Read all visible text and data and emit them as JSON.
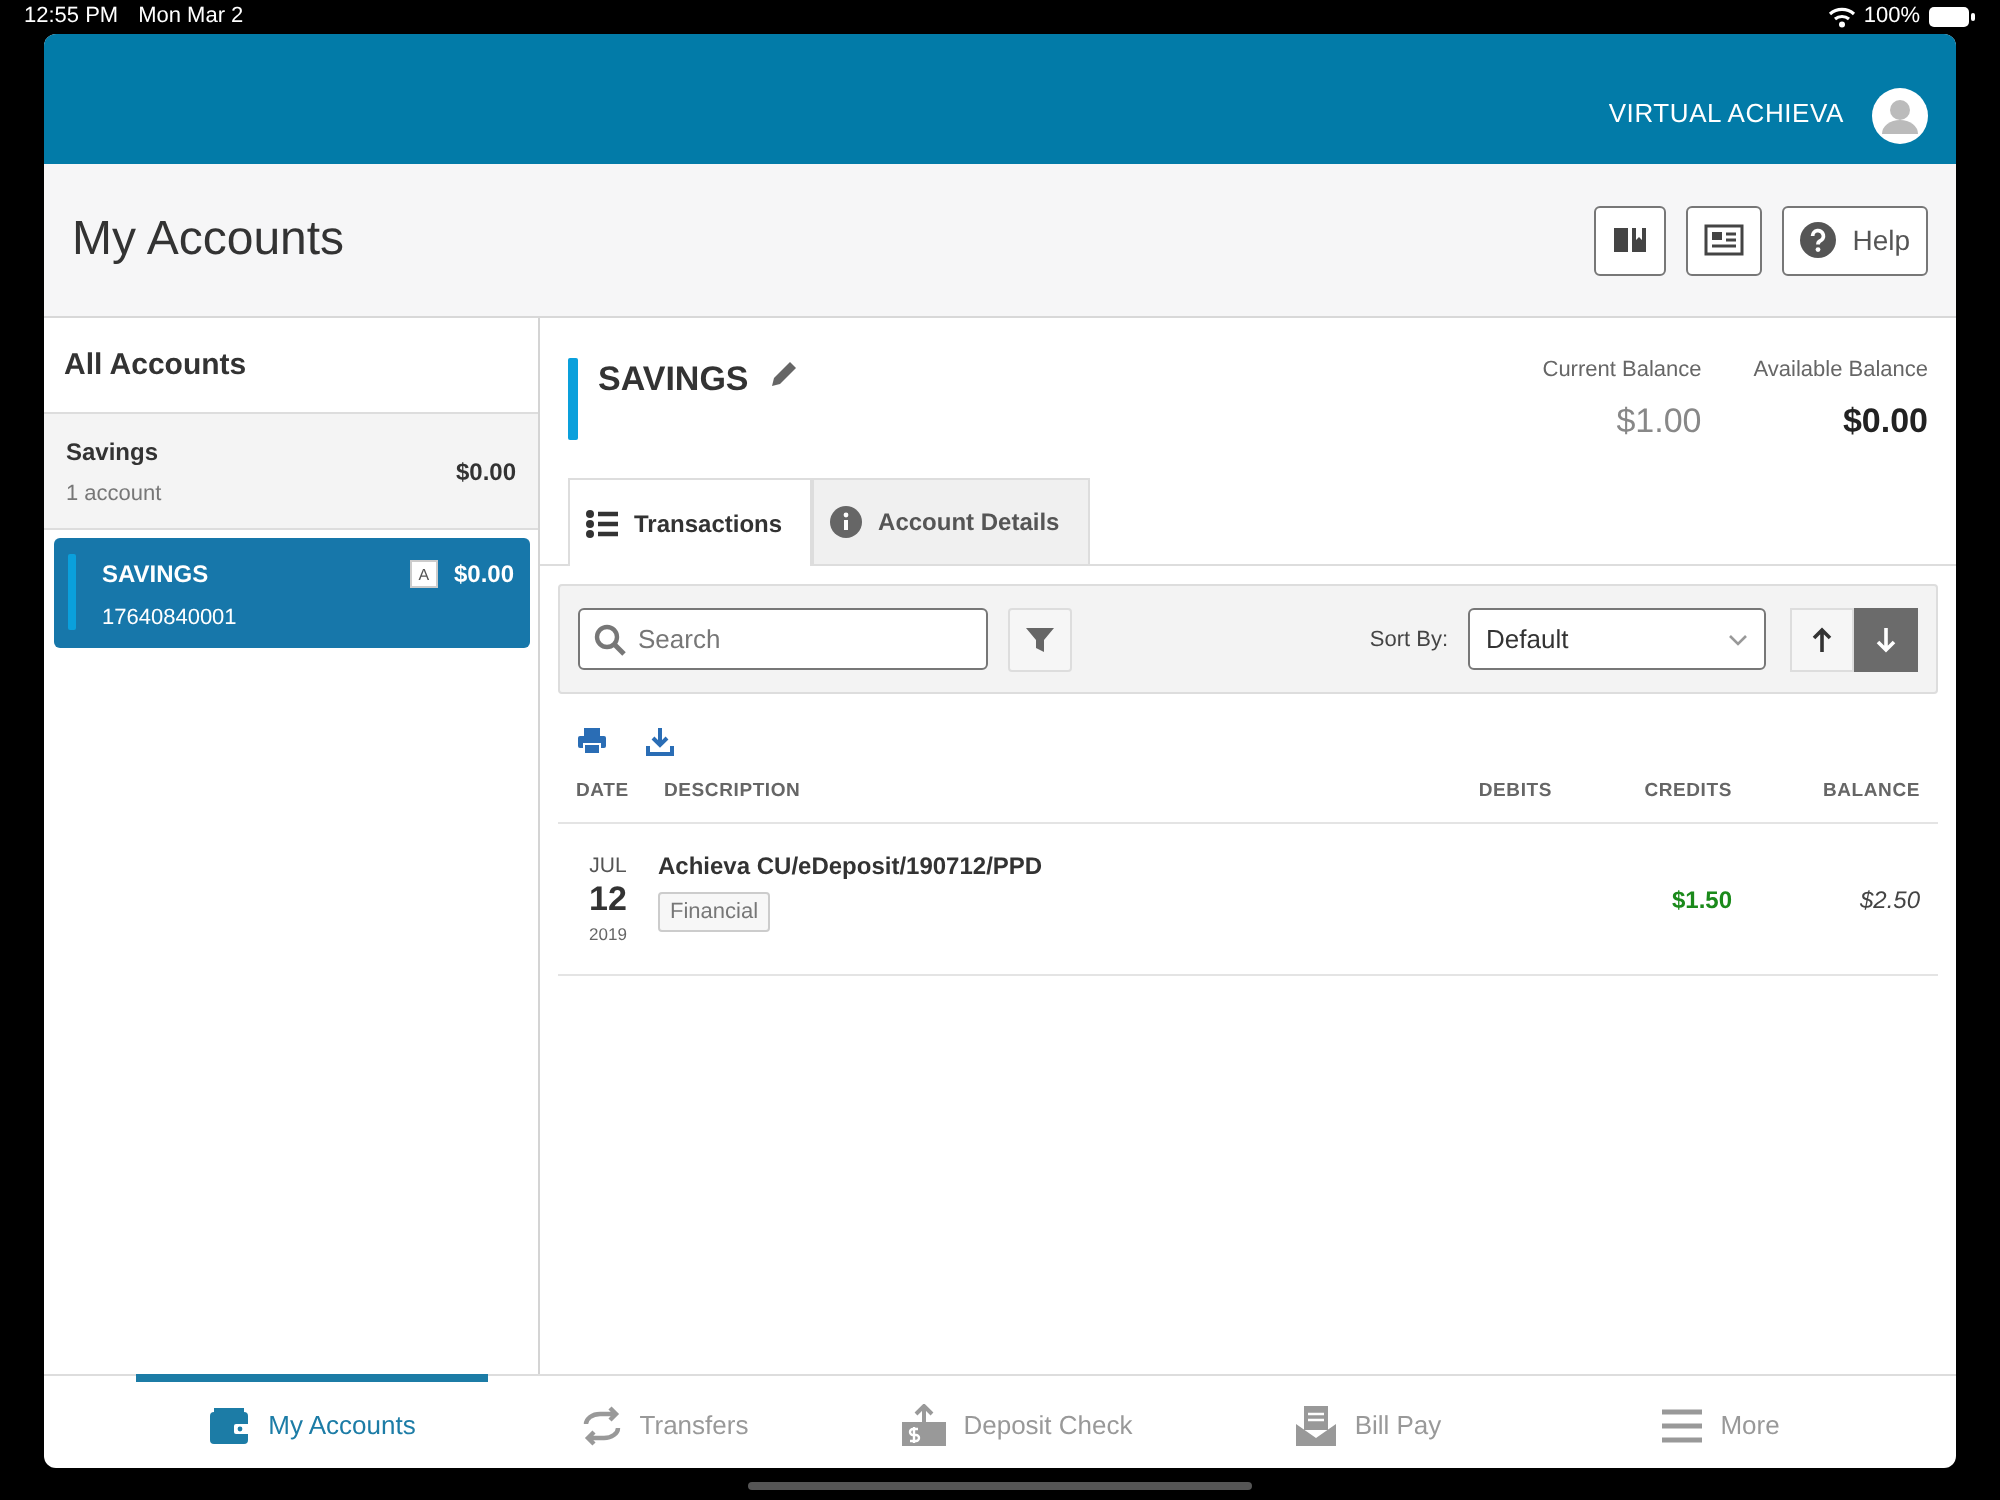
{
  "status_bar": {
    "time": "12:55 PM",
    "date": "Mon Mar 2",
    "battery": "100%"
  },
  "header": {
    "user_name": "VIRTUAL ACHIEVA"
  },
  "page": {
    "title": "My Accounts",
    "toolbar_buttons": [
      {
        "kind": "book"
      },
      {
        "kind": "news"
      },
      {
        "kind": "help",
        "label": "Help"
      }
    ]
  },
  "sidebar": {
    "title": "All Accounts",
    "groups": [
      {
        "name": "Savings",
        "count": "1 account",
        "total": "$0.00",
        "accounts": [
          {
            "name": "SAVINGS",
            "number": "17640840001",
            "badge": "A",
            "balance": "$0.00",
            "selected": true
          }
        ]
      }
    ]
  },
  "account": {
    "name": "SAVINGS",
    "current_balance_label": "Current Balance",
    "current_balance": "$1.00",
    "available_balance_label": "Available Balance",
    "available_balance": "$0.00",
    "tabs": [
      {
        "kind": "list",
        "label": "Transactions",
        "selected": true
      },
      {
        "kind": "info",
        "label": "Account Details",
        "selected": false
      }
    ],
    "search": {
      "placeholder": "Search"
    },
    "sort_label": "Sort By:",
    "sort_value": "Default",
    "sort_directions": [
      {
        "kind": "up",
        "selected": false
      },
      {
        "kind": "down",
        "selected": true
      }
    ],
    "table": {
      "columns": [
        "DATE",
        "DESCRIPTION",
        "DEBITS",
        "CREDITS",
        "BALANCE"
      ],
      "rows": [
        {
          "month": "JUL",
          "day": "12",
          "year": "2019",
          "description": "Achieva CU/eDeposit/190712/PPD",
          "tag": "Financial",
          "credit": "$1.50",
          "balance": "$2.50"
        }
      ]
    }
  },
  "nav": [
    {
      "kind": "wallet",
      "label": "My Accounts",
      "selected": true
    },
    {
      "kind": "transfer",
      "label": "Transfers",
      "selected": false
    },
    {
      "kind": "deposit",
      "label": "Deposit Check",
      "selected": false
    },
    {
      "kind": "bill",
      "label": "Bill Pay",
      "selected": false
    },
    {
      "kind": "more",
      "label": "More",
      "selected": false
    }
  ]
}
